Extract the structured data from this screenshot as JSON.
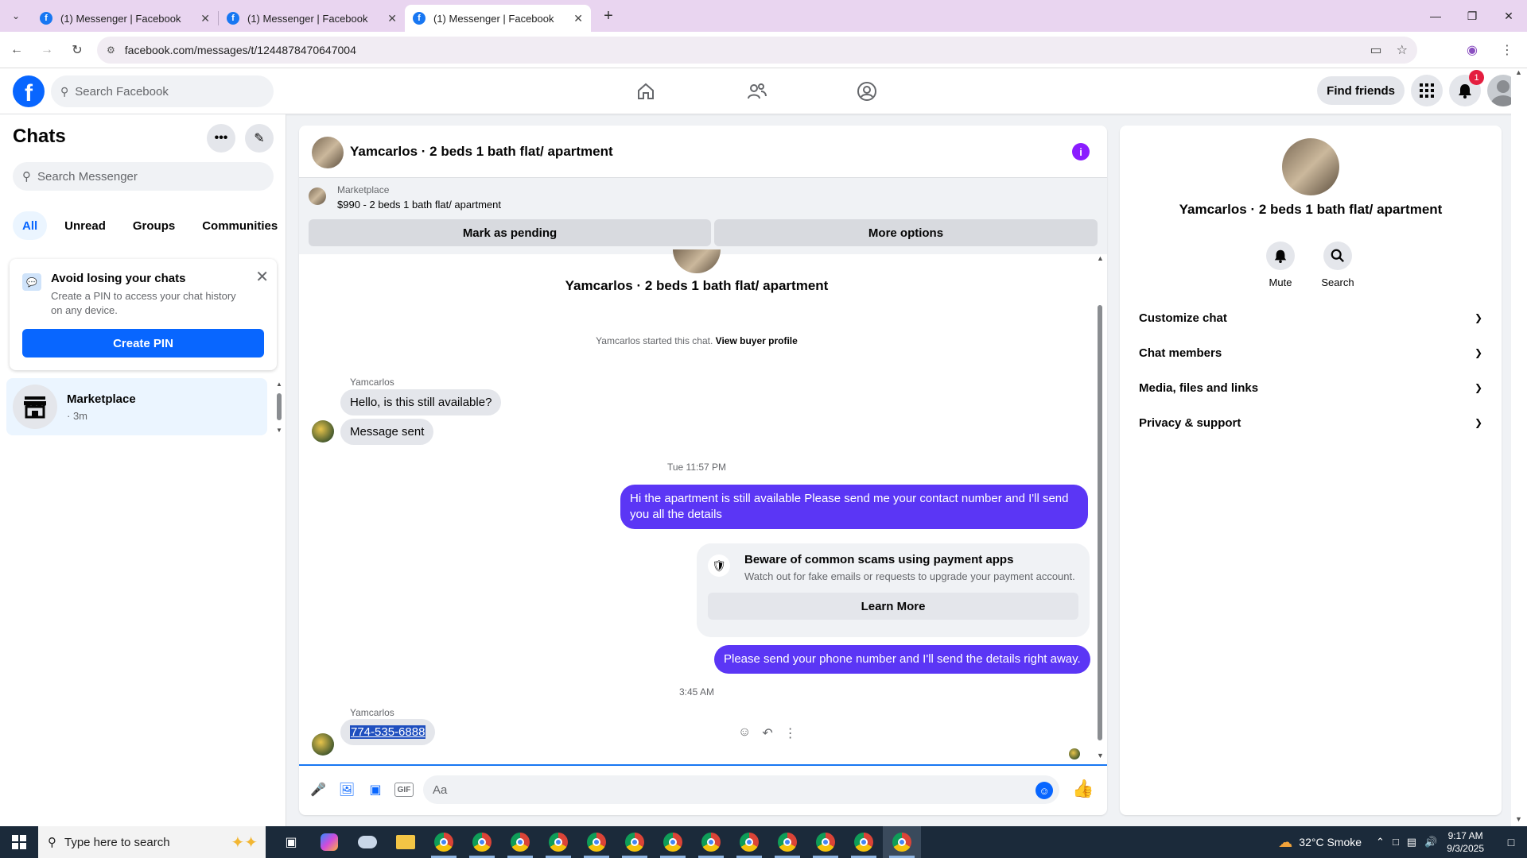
{
  "browser": {
    "tabs": [
      {
        "label": "(1) Messenger | Facebook"
      },
      {
        "label": "(1) Messenger | Facebook"
      },
      {
        "label": "(1) Messenger | Facebook"
      }
    ],
    "url": "facebook.com/messages/t/1244878470647004"
  },
  "fb_header": {
    "search_placeholder": "Search Facebook",
    "find_friends": "Find friends",
    "notification_count": "1"
  },
  "sidebar": {
    "title": "Chats",
    "search_placeholder": "Search Messenger",
    "filters": [
      "All",
      "Unread",
      "Groups",
      "Communities"
    ],
    "pin_card": {
      "title": "Avoid losing your chats",
      "description": "Create a PIN to access your chat history on any device.",
      "button": "Create PIN"
    },
    "chats": [
      {
        "name": "Marketplace",
        "time": "· 3m"
      }
    ]
  },
  "chat": {
    "title": "Yamcarlos · 2 beds 1 bath flat/ apartment",
    "marketplace_label": "Marketplace",
    "listing": "$990 - 2 beds 1 bath flat/ apartment",
    "mark_pending": "Mark as pending",
    "more_options": "More options",
    "thread_title": "Yamcarlos · 2 beds 1 bath flat/ apartment",
    "started_text": "Yamcarlos started this chat.",
    "view_buyer_profile": "View buyer profile",
    "sender1": "Yamcarlos",
    "msg_in_1": "Hello, is this still available?",
    "msg_in_2": "Message sent",
    "timestamp_1": "Tue 11:57 PM",
    "msg_out_1": "Hi the apartment is still available Please send me your contact number and I'll send you all the details",
    "scam_title": "Beware of common scams using payment apps",
    "scam_desc": "Watch out for fake emails or requests to upgrade your payment account.",
    "learn_more": "Learn More",
    "msg_out_2": "Please send your phone number and I'll send the details right away.",
    "timestamp_2": "3:45 AM",
    "sender2": "Yamcarlos",
    "msg_in_3": "774-535-6888",
    "composer_placeholder": "Aa"
  },
  "info_pane": {
    "name": "Yamcarlos · 2 beds 1 bath flat/ apartment",
    "mute": "Mute",
    "search": "Search",
    "sections": [
      "Customize chat",
      "Chat members",
      "Media, files and links",
      "Privacy & support"
    ]
  },
  "taskbar": {
    "search_placeholder": "Type here to search",
    "weather": "32°C  Smoke",
    "time": "9:17 AM",
    "date": "9/3/2025"
  },
  "colors": {
    "brand_blue": "#0866ff",
    "outgoing_bubble": "#5b36f5",
    "info_purple": "#8a1cff"
  }
}
